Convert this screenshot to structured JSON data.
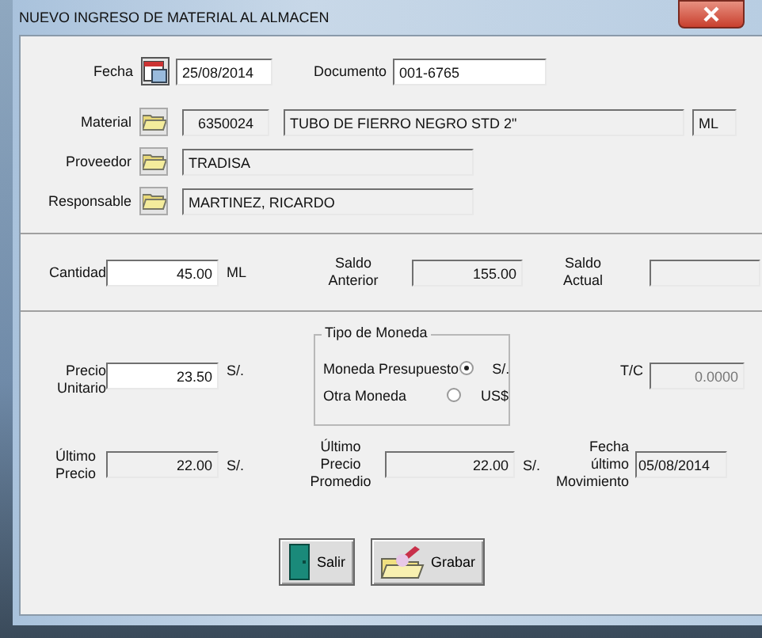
{
  "window": {
    "title": "NUEVO INGRESO DE MATERIAL AL ALMACEN"
  },
  "fecha": {
    "label": "Fecha",
    "value": "25/08/2014",
    "disabled": false
  },
  "documento": {
    "label": "Documento",
    "value": "001-6765",
    "disabled": false
  },
  "material": {
    "label": "Material",
    "code": "6350024",
    "description": "TUBO DE FIERRO NEGRO STD  2\"",
    "unit": "ML",
    "disabled": true
  },
  "proveedor": {
    "label": "Proveedor",
    "value": "TRADISA",
    "disabled": true
  },
  "responsable": {
    "label": "Responsable",
    "value": "MARTINEZ, RICARDO",
    "disabled": true
  },
  "cantidad": {
    "label": "Cantidad",
    "value": "45.00",
    "unit": "ML",
    "disabled": false
  },
  "saldo_anterior": {
    "label": "Saldo\nAnterior",
    "value": "155.00",
    "disabled": true
  },
  "saldo_actual": {
    "label": "Saldo\nActual",
    "disabled": true
  },
  "precio_unitario": {
    "label": "Precio\nUnitario",
    "value": "23.50",
    "unit": "S/.",
    "disabled": false
  },
  "tipo_de_moneda": {
    "title": "Tipo de Moneda",
    "options": [
      {
        "label": "Moneda Presupuesto",
        "currency": "S/.",
        "selected": true
      },
      {
        "label": "Otra Moneda",
        "currency": "US$",
        "selected": false
      }
    ]
  },
  "tc": {
    "label": "T/C",
    "value": "0.0000",
    "disabled": true
  },
  "ultimo_precio": {
    "label": "Último\nPrecio",
    "value": "22.00",
    "unit": "S/.",
    "disabled": true
  },
  "ultimo_precio_promedio": {
    "label": "Último\nPrecio\nPromedio",
    "value": "22.00",
    "unit": "S/.",
    "disabled": true
  },
  "fecha_ultimo_movimiento": {
    "label": "Fecha\núltimo\nMovimiento",
    "value": "05/08/2014",
    "disabled": true
  },
  "buttons": [
    {
      "label": "Salir",
      "kind": "exit"
    },
    {
      "label": "Grabar",
      "kind": "save"
    }
  ]
}
